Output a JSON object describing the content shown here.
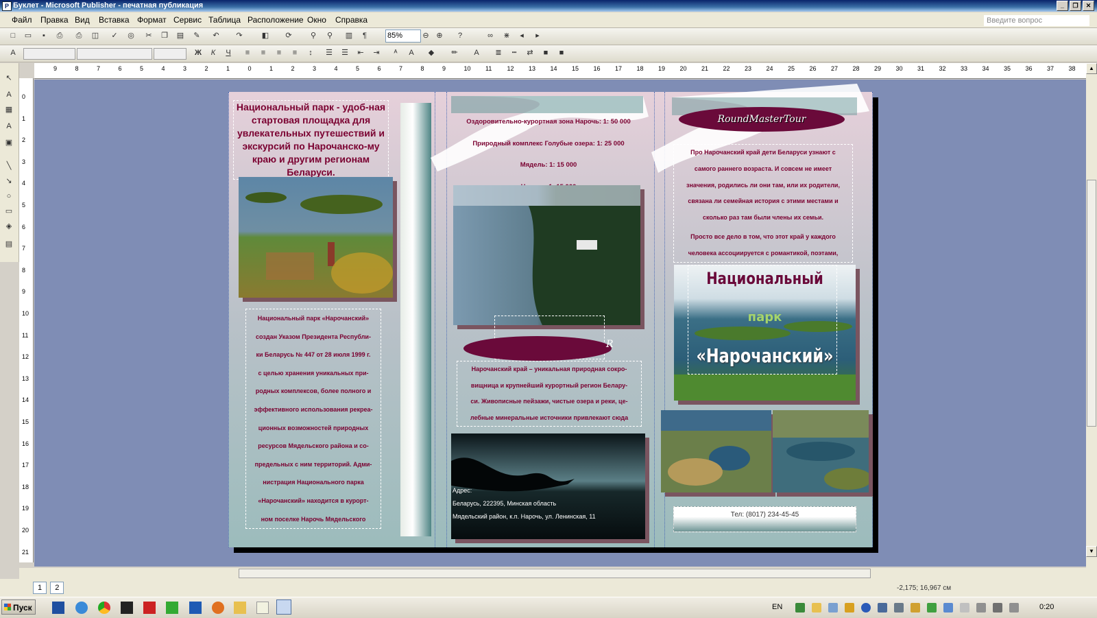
{
  "window": {
    "title": "Буклет - Microsoft Publisher - печатная публикация",
    "app_icon": "P",
    "controls": [
      "_",
      "❐",
      "✕"
    ]
  },
  "menu": {
    "items": [
      "Файл",
      "Правка",
      "Вид",
      "Вставка",
      "Формат",
      "Сервис",
      "Таблица",
      "Расположение",
      "Окно",
      "Справка"
    ],
    "ask_placeholder": "Введите вопрос"
  },
  "toolbar": {
    "zoom": "85%",
    "format_icons": [
      "Ж",
      "К",
      "Ч"
    ]
  },
  "rulers": {
    "horizontal": [
      "9",
      "8",
      "7",
      "6",
      "5",
      "4",
      "3",
      "2",
      "1",
      "0",
      "1",
      "2",
      "3",
      "4",
      "5",
      "6",
      "7",
      "8",
      "9",
      "10",
      "11",
      "12",
      "13",
      "14",
      "15",
      "16",
      "17",
      "18",
      "19",
      "20",
      "21",
      "22",
      "23",
      "24",
      "25",
      "26",
      "27",
      "28",
      "29",
      "30",
      "31",
      "32",
      "33",
      "34",
      "35",
      "36",
      "37",
      "38"
    ],
    "vertical": [
      "0",
      "1",
      "2",
      "3",
      "4",
      "5",
      "6",
      "7",
      "8",
      "9",
      "10",
      "11",
      "12",
      "13",
      "14",
      "15",
      "16",
      "17",
      "18",
      "19",
      "20",
      "21"
    ]
  },
  "brochure": {
    "panel1": {
      "headline": "Национальный парк - удоб-ная стартовая площадка для увлекательных путешествий и экскурсий по Нарочанско-му краю и другим регионам Беларуси.",
      "body": [
        "Национальный парк «Нарочанский»",
        "создан Указом Президента Республи-",
        "ки Беларусь № 447 от 28 июля 1999 г.",
        "с целью хранения уникальных при-",
        "родных комплексов, более полного и",
        "эффективного использования рекреа-",
        "ционных возможностей природных",
        "ресурсов Мядельского района и со-",
        "предельных с ним территорий. Адми-",
        "нистрация Национального парка",
        "«Нарочанский» находится в курорт-",
        "ном поселке Нарочь Мядельского"
      ]
    },
    "panel2": {
      "scales": [
        "Оздоровительно-курортная зона Нарочь: 1: 50 000",
        "Природный комплекс Голубые озера: 1: 25 000",
        "Мядель: 1: 15 000",
        "Нарочь: 1: 15 000"
      ],
      "ellipse_letter": "R",
      "body": [
        "Нарочанский край – уникальная природная сокро-",
        "вищница и крупнейший курортный регион Белару-",
        "си. Живописные пейзажи, чистые озера и реки, це-",
        "лебные минеральные источники привлекают сюда"
      ],
      "address": [
        "Адрес:",
        "Беларусь, 222395, Минская область",
        "Мядельский район, к.п. Нарочь, ул. Ленинская, 11"
      ]
    },
    "panel3": {
      "brand": "RoundMasterTour",
      "body": [
        "Про Нарочанский край дети Беларуси узнают с",
        "самого раннего возраста. И совсем не имеет",
        "значения, родились ли они там, или их родители,",
        "связана ли семейная история с этими местами и",
        "сколько раз там были члены их семьи.",
        "Просто все дело в том, что этот край у каждого",
        "человека ассоциируется с романтикой, поэтами,"
      ],
      "park_title": {
        "line1": "Национальный",
        "line2": "парк",
        "line3": "«Нарочанский»"
      },
      "phone": "Тел: (8017) 234-45-45"
    }
  },
  "status": {
    "pages": [
      "1",
      "2"
    ],
    "coords": "-2,175; 16,967 см"
  },
  "taskbar": {
    "start": "Пуск",
    "lang": "EN",
    "clock": "0:20"
  },
  "colors": {
    "accent": "#7a0030",
    "ellipse": "#6a0a3a",
    "workspace": "#7f8db5"
  }
}
